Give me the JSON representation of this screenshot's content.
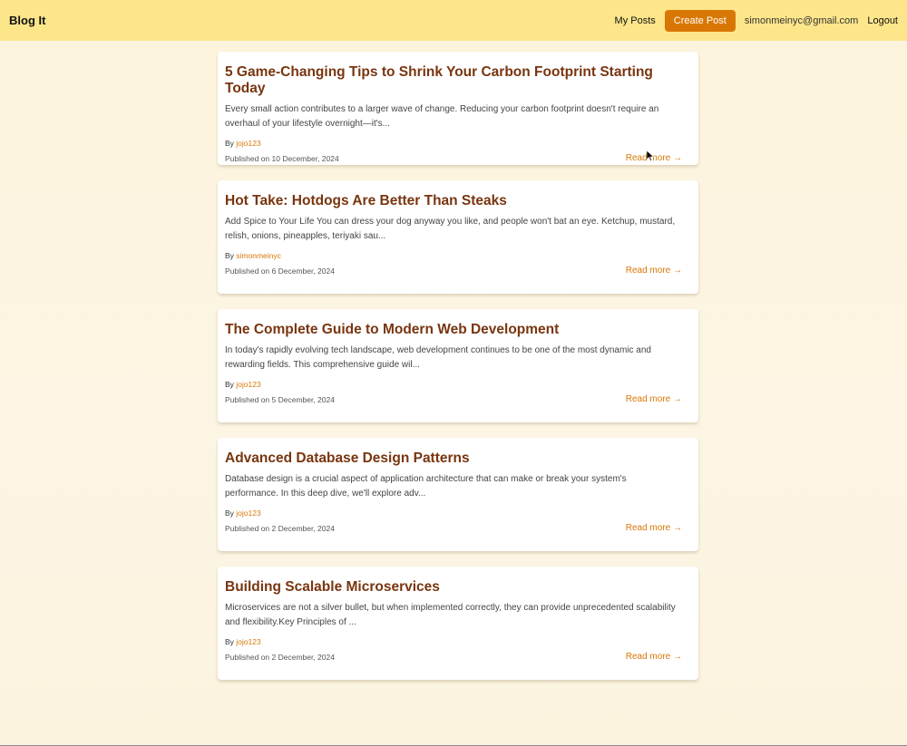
{
  "navbar": {
    "brand": "Blog It",
    "my_posts": "My Posts",
    "create_post": "Create Post",
    "email": "simonmeinyc@gmail.com",
    "logout": "Logout",
    "bg_color": "#fde68a",
    "accent_color": "#d97706"
  },
  "posts": [
    {
      "title": "5 Game-Changing Tips to Shrink Your Carbon Footprint Starting Today",
      "excerpt": "Every small action contributes to a larger wave of change. Reducing your carbon footprint doesn't require an overhaul of your lifestyle overnight—it's...",
      "by": "By",
      "author": "jojo123",
      "published": "Published on 10 December, 2024",
      "read_more": "Read more →"
    },
    {
      "title": "Hot Take: Hotdogs Are Better Than Steaks",
      "excerpt": "Add Spice to Your Life You can dress your dog anyway you like, and people won't bat an eye. Ketchup, mustard, relish, onions, pineapples, teriyaki sau...",
      "by": "By",
      "author": "simonmeinyc",
      "published": "Published on 6 December, 2024",
      "read_more": "Read more →"
    },
    {
      "title": "The Complete Guide to Modern Web Development",
      "excerpt": "In today's rapidly evolving tech landscape, web development continues to be one of the most dynamic and rewarding fields. This comprehensive guide wil...",
      "by": "By",
      "author": "jojo123",
      "published": "Published on 5 December, 2024",
      "read_more": "Read more →"
    },
    {
      "title": "Advanced Database Design Patterns",
      "excerpt": "Database design is a crucial aspect of application architecture that can make or break your system's performance. In this deep dive, we'll explore adv...",
      "by": "By",
      "author": "jojo123",
      "published": "Published on 2 December, 2024",
      "read_more": "Read more →"
    },
    {
      "title": "Building Scalable Microservices",
      "excerpt": "Microservices are not a silver bullet, but when implemented correctly, they can provide unprecedented scalability and flexibility.Key Principles of ...",
      "by": "By",
      "author": "jojo123",
      "published": "Published on 2 December, 2024",
      "read_more": "Read more →"
    }
  ]
}
